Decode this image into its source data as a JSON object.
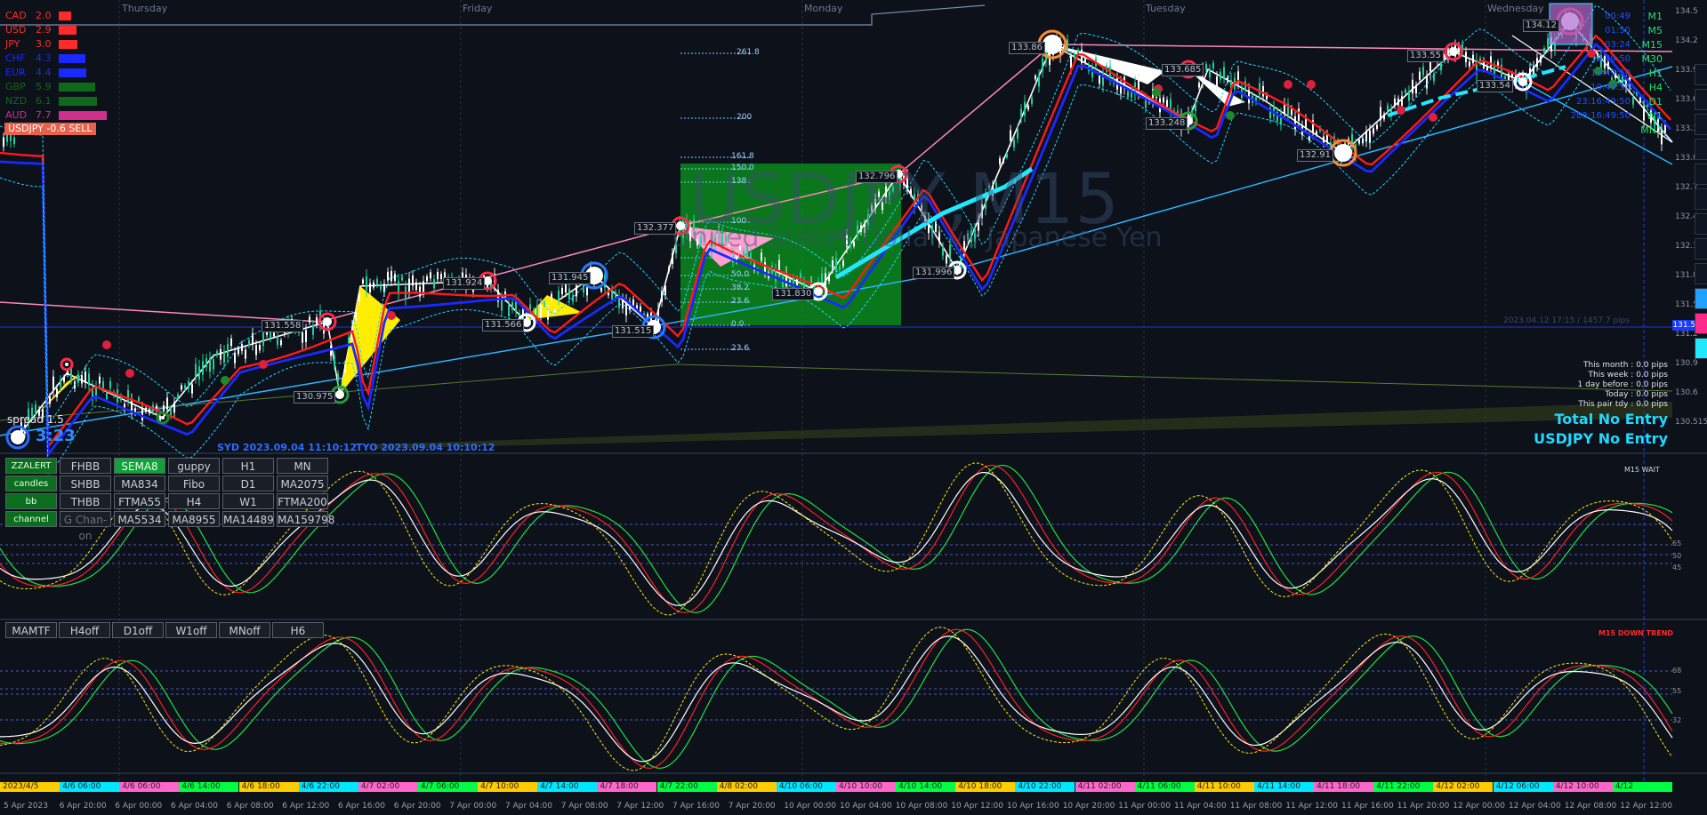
{
  "currency_strength": [
    {
      "currency": "CAD",
      "value": "2.0",
      "color": "#ff2a2a"
    },
    {
      "currency": "USD",
      "value": "2.9",
      "color": "#ff2a2a"
    },
    {
      "currency": "JPY",
      "value": "3.0",
      "color": "#ff2a2a"
    },
    {
      "currency": "CHF",
      "value": "4.3",
      "color": "#1a2aff"
    },
    {
      "currency": "EUR",
      "value": "4.4",
      "color": "#1a2aff"
    },
    {
      "currency": "GBP",
      "value": "5.9",
      "color": "#0e6a18"
    },
    {
      "currency": "NZD",
      "value": "6.1",
      "color": "#0e6a18"
    },
    {
      "currency": "AUD",
      "value": "7.7",
      "color": "#d0308c"
    }
  ],
  "signal": "USDJPY -0.6 SELL",
  "days": [
    "Thursday",
    "Friday",
    "Monday",
    "Tuesday",
    "Wednesday"
  ],
  "watermark": {
    "symbol": "USDJPY,M15",
    "description": "United States Dollar vs Japanese Yen"
  },
  "price_labels": [
    "130.975",
    "131.558",
    "131.924",
    "131.566",
    "131.945",
    "131.515",
    "132.377",
    "131.830",
    "132.796",
    "131.996",
    "133.86",
    "133.685",
    "133.248",
    "132.91",
    "133.55",
    "133.54",
    "134.12"
  ],
  "fibo_levels": [
    "261.8",
    "200",
    "161.8",
    "150.0",
    "138",
    "100",
    "61.8",
    "50.0",
    "38.2",
    "23.6",
    "0.0",
    "23.6"
  ],
  "stats": [
    "This month : 0.0 pips",
    "This week : 0.0 pips",
    "1 day before : 0.0 pips",
    "Today : 0.0 pips",
    "This pair tdy : 0.0 pips"
  ],
  "status_total": "Total No Entry",
  "status_pair": "USDJPY No Entry",
  "spread": "spread 1.5",
  "price_counter": "3:23",
  "sessions": {
    "syd": "SYD 2023.09.04 11:10:12",
    "tyo": "TYO 2023.09.04 10:10:12"
  },
  "timeframes": [
    "M1",
    "M5",
    "M15",
    "M30",
    "H1",
    "H4",
    "D1",
    "W1",
    "MN1"
  ],
  "tf_times": [
    "00:49",
    "01:50",
    "03:24",
    "10:49:50",
    "10:49:50",
    "10:49:50",
    "23:16:49:50",
    "283:16:49:50"
  ],
  "line_note": "2023.04.12 17:15 / 1457.7 pips",
  "button_panel": {
    "rows": [
      [
        "ZZALERT",
        "FHBB",
        "SEMA8",
        "guppy",
        "H1",
        "MN"
      ],
      [
        "candles",
        "SHBB",
        "MA834",
        "Fibo",
        "D1",
        "MA2075"
      ],
      [
        "bb",
        "THBB",
        "FTMA55",
        "H4",
        "W1",
        "FTMA200"
      ],
      [
        "channel",
        "G Chan-on",
        "MA5534",
        "MA8955",
        "MA14489",
        "MA159798"
      ]
    ]
  },
  "mamtf_buttons": [
    "MAMTF",
    "H4off",
    "D1off",
    "W1off",
    "MNoff",
    "H6"
  ],
  "osc1_tag": "M15 WAIT",
  "osc2_tag": "M15 DOWN TREND",
  "osc1_levels": [
    "65",
    "50",
    "45"
  ],
  "osc2_levels": [
    "68",
    "55",
    "32"
  ],
  "time_axis": [
    "2023/4/5",
    "4/6 06:00",
    "4/6 06:00",
    "4/6 14:00",
    "4/6 18:00",
    "4/6 22:00",
    "4/7 02:00",
    "4/7 06:00",
    "4/7 10:00",
    "4/7 14:00",
    "4/7 18:00",
    "4/7 22:00",
    "4/8 02:00",
    "4/10 06:00",
    "4/10 10:00",
    "4/10 14:00",
    "4/10 18:00",
    "4/10 22:00",
    "4/11 02:00",
    "4/11 06:00",
    "4/11 10:00",
    "4/11 14:00",
    "4/11 18:00",
    "4/11 22:00",
    "4/12 02:00",
    "4/12 06:00",
    "4/12 10:00",
    "4/12"
  ],
  "time_axis_colors": [
    "#ffcc00",
    "#00e8ff",
    "#ff66cc",
    "#00ff44"
  ],
  "date_axis": [
    "5 Apr 2023",
    "6 Apr 20:00",
    "6 Apr 00:00",
    "6 Apr 04:00",
    "6 Apr 08:00",
    "6 Apr 12:00",
    "6 Apr 16:00",
    "6 Apr 20:00",
    "7 Apr 00:00",
    "7 Apr 04:00",
    "7 Apr 08:00",
    "7 Apr 12:00",
    "7 Apr 16:00",
    "7 Apr 20:00",
    "10 Apr 00:00",
    "10 Apr 04:00",
    "10 Apr 08:00",
    "10 Apr 12:00",
    "10 Apr 16:00",
    "10 Apr 20:00",
    "11 Apr 00:00",
    "11 Apr 04:00",
    "11 Apr 08:00",
    "11 Apr 12:00",
    "11 Apr 16:00",
    "11 Apr 20:00",
    "12 Apr 00:00",
    "12 Apr 04:00",
    "12 Apr 08:00",
    "12 Apr 12:00"
  ],
  "price_axis": [
    "134.5",
    "134.2",
    "133.9",
    "133.6",
    "133.3",
    "133.0",
    "132.7",
    "132.4",
    "132.1",
    "131.8",
    "131.5",
    "131.2",
    "130.9",
    "130.6",
    "130.515"
  ],
  "current_price": "131.525",
  "icons": [
    "eye-icon",
    "crosshair-icon",
    "pencil-icon",
    "ruler-icon",
    "tag-icon",
    "trash-icon",
    "magnet-icon",
    "camera-icon",
    "zoom-icon",
    "color-blue-icon",
    "color-pink-icon",
    "color-cyan-icon"
  ]
}
